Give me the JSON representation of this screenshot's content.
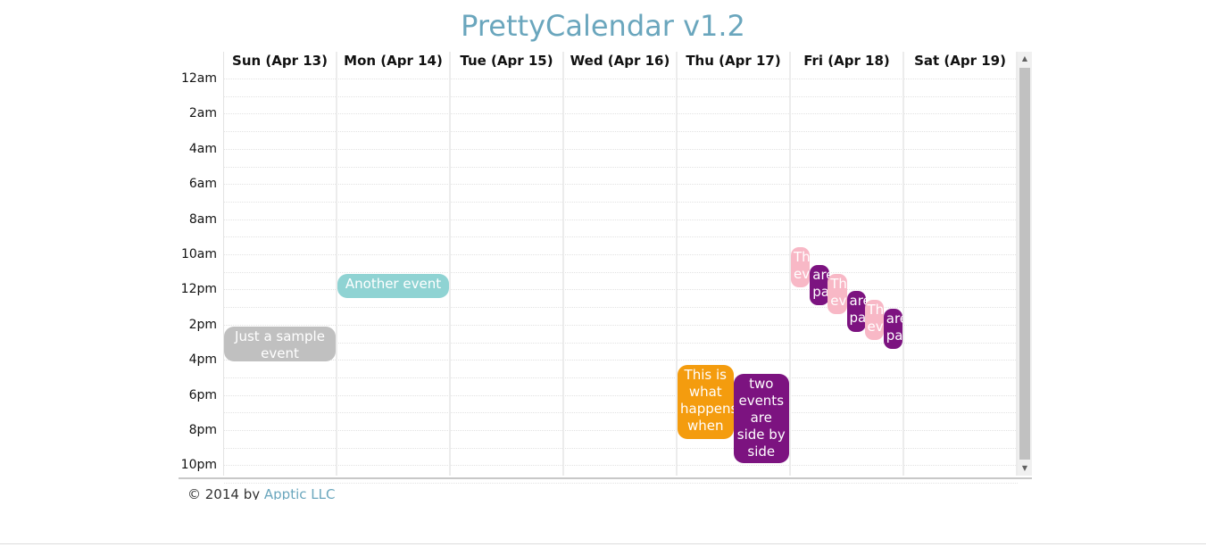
{
  "app": {
    "title": "PrettyCalendar v1.2"
  },
  "days": [
    {
      "label": "Sun (Apr 13)"
    },
    {
      "label": "Mon (Apr 14)"
    },
    {
      "label": "Tue (Apr 15)"
    },
    {
      "label": "Wed (Apr 16)"
    },
    {
      "label": "Thu (Apr 17)"
    },
    {
      "label": "Fri (Apr 18)"
    },
    {
      "label": "Sat (Apr 19)"
    }
  ],
  "hours": [
    "12am",
    "2am",
    "4am",
    "6am",
    "8am",
    "10am",
    "12pm",
    "2pm",
    "4pm",
    "6pm",
    "8pm",
    "10pm"
  ],
  "events": [
    {
      "text": "Just a sample event",
      "day": 0,
      "start": 14.5,
      "end": 16.5,
      "color": "#c0c0c0"
    },
    {
      "text": "Another event",
      "day": 1,
      "start": 11.5,
      "end": 12.9,
      "color": "#8fd3d3"
    },
    {
      "text": "This is what happens when",
      "day": 4,
      "start": 16.7,
      "end": 20.9,
      "color": "#f49c0e",
      "lane": 0,
      "lanes": 2
    },
    {
      "text": "two events are side by side",
      "day": 4,
      "start": 17.2,
      "end": 22.3,
      "color": "#7c1380",
      "lane": 1,
      "lanes": 2
    },
    {
      "text": "This event",
      "day": 5,
      "start": 10.0,
      "end": 12.3,
      "color": "#f8b8c6",
      "x": 0.0,
      "w": 0.17
    },
    {
      "text": "are partly",
      "day": 5,
      "start": 11.0,
      "end": 13.3,
      "color": "#7c1380",
      "x": 0.17,
      "w": 0.17
    },
    {
      "text": "This event",
      "day": 5,
      "start": 11.5,
      "end": 13.8,
      "color": "#f8b8c6",
      "x": 0.33,
      "w": 0.17
    },
    {
      "text": "are partly",
      "day": 5,
      "start": 12.5,
      "end": 14.8,
      "color": "#7c1380",
      "x": 0.5,
      "w": 0.17
    },
    {
      "text": "This event",
      "day": 5,
      "start": 13.0,
      "end": 15.3,
      "color": "#f8b8c6",
      "x": 0.66,
      "w": 0.17
    },
    {
      "text": "are partly",
      "day": 5,
      "start": 13.5,
      "end": 15.8,
      "color": "#7c1380",
      "x": 0.83,
      "w": 0.17
    }
  ],
  "footer": {
    "prefix": "© 2014 by ",
    "company": "Apptic LLC"
  }
}
